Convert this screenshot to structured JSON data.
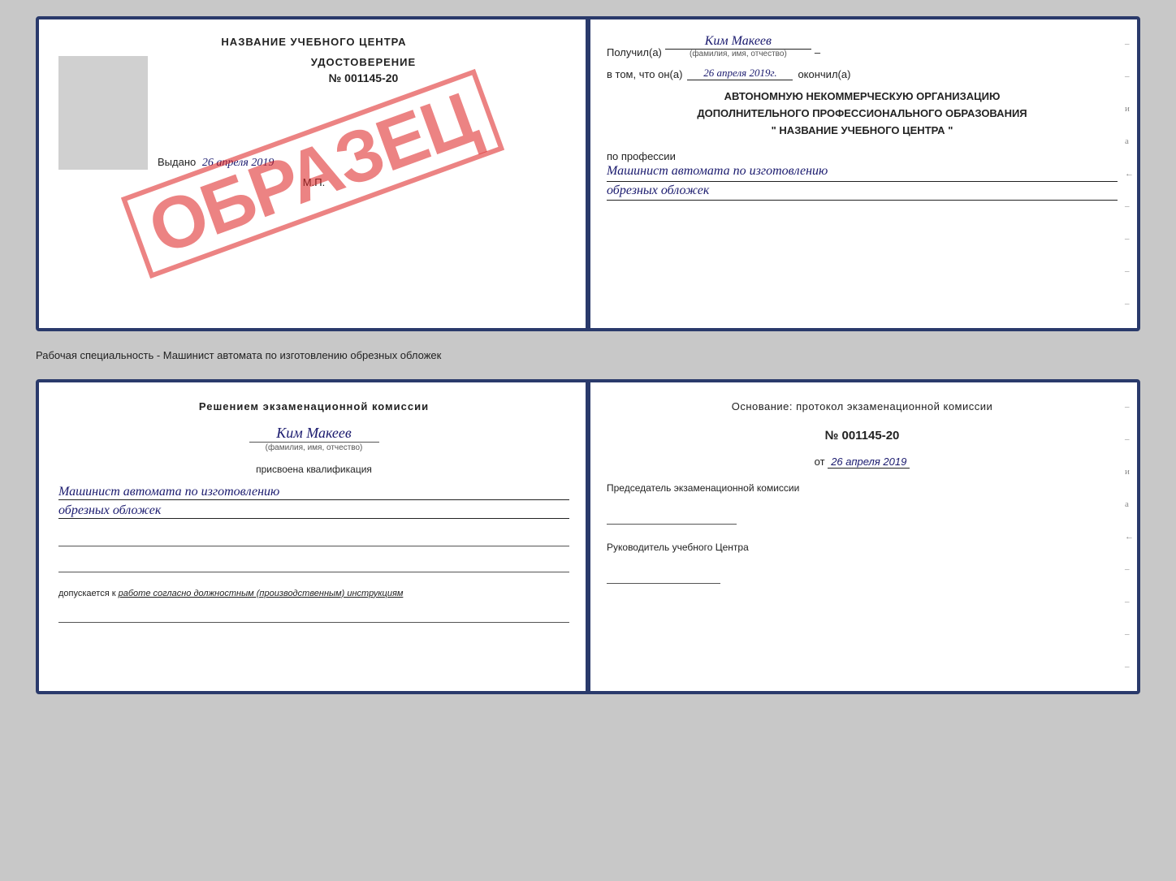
{
  "top": {
    "left": {
      "training_center_label": "НАЗВАНИЕ УЧЕБНОГО ЦЕНТРА",
      "cert_title": "УДОСТОВЕРЕНИЕ",
      "cert_number": "№ 001145-20",
      "issued_label": "Выдано",
      "issued_date": "26 апреля 2019",
      "mp_label": "М.П.",
      "stamp_text": "ОБРАЗЕЦ"
    },
    "right": {
      "received_label": "Получил(а)",
      "received_name": "Ким Макеев",
      "fio_label": "(фамилия, имя, отчество)",
      "dash": "–",
      "vtom_label": "в том, что он(а)",
      "date_value": "26 апреля 2019г.",
      "okonchil_label": "окончил(а)",
      "org_line1": "АВТОНОМНУЮ НЕКОММЕРЧЕСКУЮ ОРГАНИЗАЦИЮ",
      "org_line2": "ДОПОЛНИТЕЛЬНОГО ПРОФЕССИОНАЛЬНОГО ОБРАЗОВАНИЯ",
      "org_quote": "\"",
      "org_name": "НАЗВАНИЕ УЧЕБНОГО ЦЕНТРА",
      "po_professii_label": "по профессии",
      "profession_line1": "Машинист автомата по изготовлению",
      "profession_line2": "обрезных обложек"
    }
  },
  "between_label": "Рабочая специальность - Машинист автомата по изготовлению обрезных обложек",
  "bottom": {
    "left": {
      "decision_line1": "Решением  экзаменационной  комиссии",
      "person_name": "Ким Макеев",
      "fio_label": "(фамилия, имя, отчество)",
      "assigned_text": "присвоена квалификация",
      "qualification_line1": "Машинист автомата по изготовлению",
      "qualification_line2": "обрезных обложек",
      "допуск_prefix": "допускается к",
      "допуск_text": "работе согласно должностным (производственным) инструкциям"
    },
    "right": {
      "osnov_label": "Основание: протокол экзаменационной  комиссии",
      "protocol_number": "№  001145-20",
      "date_prefix": "от",
      "date_value": "26 апреля 2019",
      "predsed_label": "Председатель экзаменационной комиссии",
      "ruk_label": "Руководитель учебного Центра"
    }
  }
}
